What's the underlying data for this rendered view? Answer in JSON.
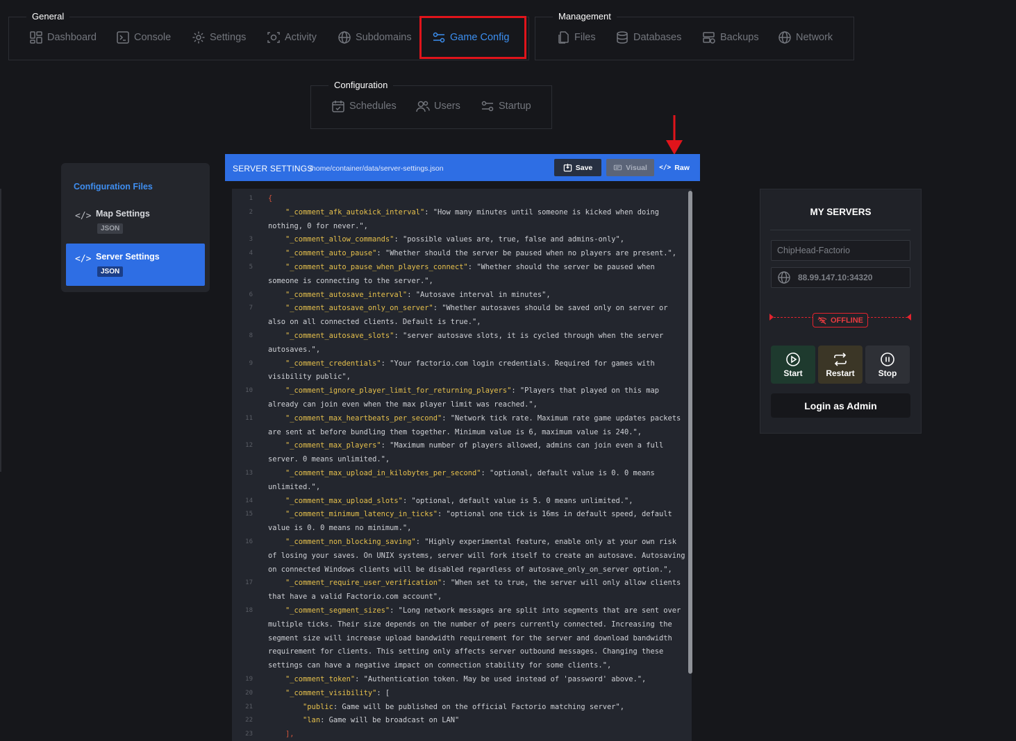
{
  "nav": {
    "general": {
      "legend": "General",
      "items": [
        {
          "label": "Dashboard",
          "icon": "dashboard-icon"
        },
        {
          "label": "Console",
          "icon": "console-icon"
        },
        {
          "label": "Settings",
          "icon": "settings-icon"
        },
        {
          "label": "Activity",
          "icon": "activity-icon"
        },
        {
          "label": "Subdomains",
          "icon": "globe-icon"
        },
        {
          "label": "Game Config",
          "icon": "config-sliders-icon",
          "active": true
        }
      ]
    },
    "management": {
      "legend": "Management",
      "items": [
        {
          "label": "Files",
          "icon": "files-icon"
        },
        {
          "label": "Databases",
          "icon": "database-icon"
        },
        {
          "label": "Backups",
          "icon": "backups-icon"
        },
        {
          "label": "Network",
          "icon": "network-icon"
        }
      ]
    },
    "configuration": {
      "legend": "Configuration",
      "items": [
        {
          "label": "Schedules",
          "icon": "calendar-icon"
        },
        {
          "label": "Users",
          "icon": "users-icon"
        },
        {
          "label": "Startup",
          "icon": "startup-sliders-icon"
        }
      ]
    }
  },
  "files_panel": {
    "title": "Configuration Files",
    "items": [
      {
        "name": "Map Settings",
        "type": "JSON",
        "icon": "code-icon"
      },
      {
        "name": "Server Settings",
        "type": "JSON",
        "icon": "code-icon",
        "active": true
      }
    ]
  },
  "editor": {
    "title": "SERVER SETTINGS",
    "path": "/home/container/data/server-settings.json",
    "buttons": {
      "save": "Save",
      "visual": "Visual",
      "raw": "Raw"
    },
    "lines": [
      {
        "n": "1",
        "key": "",
        "text": "{"
      },
      {
        "n": "2",
        "key": "\"_comment_afk_autokick_interval\"",
        "text": ": \"How many minutes until someone is kicked when doing nothing, 0 for never.\","
      },
      {
        "n": "3",
        "key": "\"_comment_allow_commands\"",
        "text": ": \"possible values are, true, false and admins-only\","
      },
      {
        "n": "4",
        "key": "\"_comment_auto_pause\"",
        "text": ": \"Whether should the server be paused when no players are present.\","
      },
      {
        "n": "5",
        "key": "\"_comment_auto_pause_when_players_connect\"",
        "text": ": \"Whether should the server be paused when someone is connecting to the server.\","
      },
      {
        "n": "6",
        "key": "\"_comment_autosave_interval\"",
        "text": ": \"Autosave interval in minutes\","
      },
      {
        "n": "7",
        "key": "\"_comment_autosave_only_on_server\"",
        "text": ": \"Whether autosaves should be saved only on server or also on all connected clients. Default is true.\","
      },
      {
        "n": "8",
        "key": "\"_comment_autosave_slots\"",
        "text": ": \"server autosave slots, it is cycled through when the server autosaves.\","
      },
      {
        "n": "9",
        "key": "\"_comment_credentials\"",
        "text": ": \"Your factorio.com login credentials. Required for games with visibility public\","
      },
      {
        "n": "10",
        "key": "\"_comment_ignore_player_limit_for_returning_players\"",
        "text": ": \"Players that played on this map already can join even when the max player limit was reached.\","
      },
      {
        "n": "11",
        "key": "\"_comment_max_heartbeats_per_second\"",
        "text": ": \"Network tick rate. Maximum rate game updates packets are sent at before bundling them together. Minimum value is 6, maximum value is 240.\","
      },
      {
        "n": "12",
        "key": "\"_comment_max_players\"",
        "text": ": \"Maximum number of players allowed, admins can join even a full server. 0 means unlimited.\","
      },
      {
        "n": "13",
        "key": "\"_comment_max_upload_in_kilobytes_per_second\"",
        "text": ": \"optional, default value is 0. 0 means unlimited.\","
      },
      {
        "n": "14",
        "key": "\"_comment_max_upload_slots\"",
        "text": ": \"optional, default value is 5. 0 means unlimited.\","
      },
      {
        "n": "15",
        "key": "\"_comment_minimum_latency_in_ticks\"",
        "text": ": \"optional one tick is 16ms in default speed, default value is 0. 0 means no minimum.\","
      },
      {
        "n": "16",
        "key": "\"_comment_non_blocking_saving\"",
        "text": ": \"Highly experimental feature, enable only at your own risk of losing your saves. On UNIX systems, server will fork itself to create an autosave. Autosaving on connected Windows clients will be disabled regardless of autosave_only_on_server option.\","
      },
      {
        "n": "17",
        "key": "\"_comment_require_user_verification\"",
        "text": ": \"When set to true, the server will only allow clients that have a valid Factorio.com account\","
      },
      {
        "n": "18",
        "key": "\"_comment_segment_sizes\"",
        "text": ": \"Long network messages are split into segments that are sent over multiple ticks. Their size depends on the number of peers currently connected. Increasing the segment size will increase upload bandwidth requirement for the server and download bandwidth requirement for clients. This setting only affects server outbound messages. Changing these settings can have a negative impact on connection stability for some clients.\","
      },
      {
        "n": "19",
        "key": "\"_comment_token\"",
        "text": ": \"Authentication token. May be used instead of 'password' above.\","
      },
      {
        "n": "20",
        "key": "\"_comment_visibility\"",
        "text": ": ["
      },
      {
        "n": "21",
        "key": "\"public",
        "text": ": Game will be published on the official Factorio matching server\","
      },
      {
        "n": "22",
        "key": "\"lan",
        "text": ": Game will be broadcast on LAN\""
      },
      {
        "n": "23",
        "key": "",
        "text": "],"
      }
    ]
  },
  "servers_panel": {
    "title": "MY SERVERS",
    "server_name": "ChipHead-Factorio",
    "address": "88.99.147.10:34320",
    "status": "OFFLINE",
    "buttons": {
      "start": "Start",
      "restart": "Restart",
      "stop": "Stop"
    },
    "admin_login": "Login as Admin"
  },
  "colors": {
    "accent": "#2e6ee4",
    "active_nav": "#3c8ff0",
    "highlight": "#e0141b",
    "offline": "#e4232e",
    "json_key": "#e6c04c"
  }
}
